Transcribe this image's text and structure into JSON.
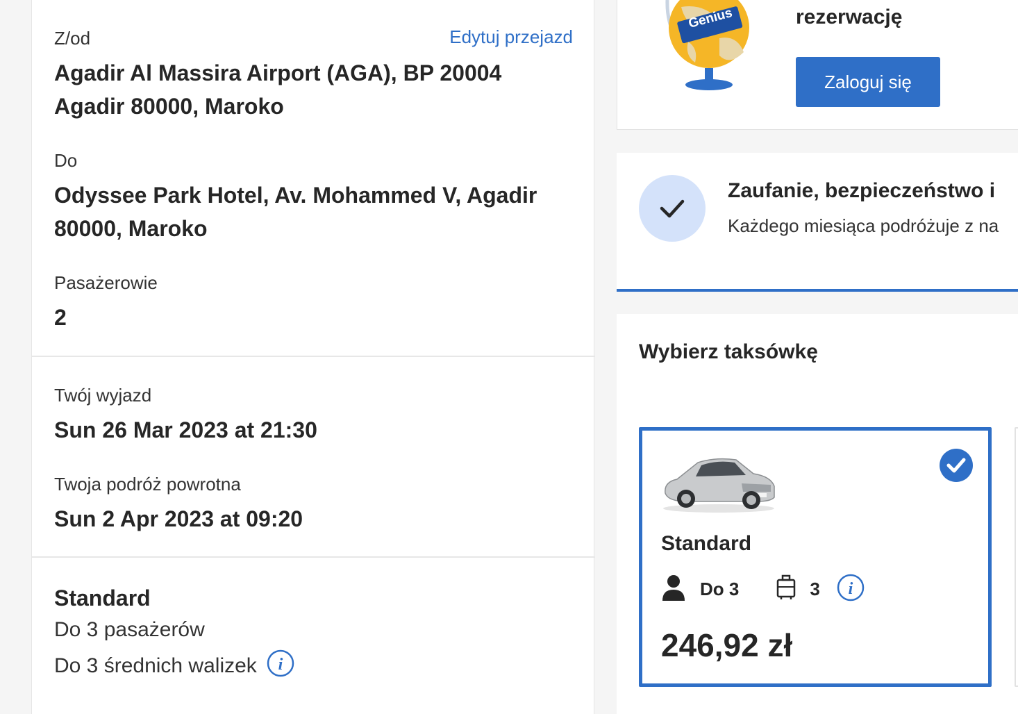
{
  "summary": {
    "from_label": "Z/od",
    "edit_link": "Edytuj przejazd",
    "from_value_line1": "Agadir Al Massira Airport (AGA), BP 20004",
    "from_value_line2": "Agadir 80000, Maroko",
    "to_label": "Do",
    "to_value_line1": "Odyssee Park Hotel, Av. Mohammed V, Agadir",
    "to_value_line2": "80000, Maroko",
    "passengers_label": "Pasażerowie",
    "passengers_value": "2",
    "departure_label": "Twój wyjazd",
    "departure_value": "Sun 26 Mar 2023 at 21:30",
    "return_label": "Twoja podróż powrotna",
    "return_value": "Sun 2 Apr 2023 at 09:20",
    "vehicle_name": "Standard",
    "vehicle_passengers": "Do 3 pasażerów",
    "vehicle_luggage": "Do 3 średnich walizek"
  },
  "genius": {
    "badge": "Genius",
    "title": "rezerwację",
    "login_button": "Zaloguj się"
  },
  "trust": {
    "title": "Zaufanie, bezpieczeństwo i",
    "subtitle": "Każdego miesiąca podróżuje z na"
  },
  "taxi": {
    "title": "Wybierz taksówkę",
    "option": {
      "name": "Standard",
      "passengers": "Do 3",
      "bags": "3",
      "price": "246,92 zł"
    }
  },
  "colors": {
    "accent": "#2f6fc7",
    "check_bg": "#d4e2fa"
  }
}
